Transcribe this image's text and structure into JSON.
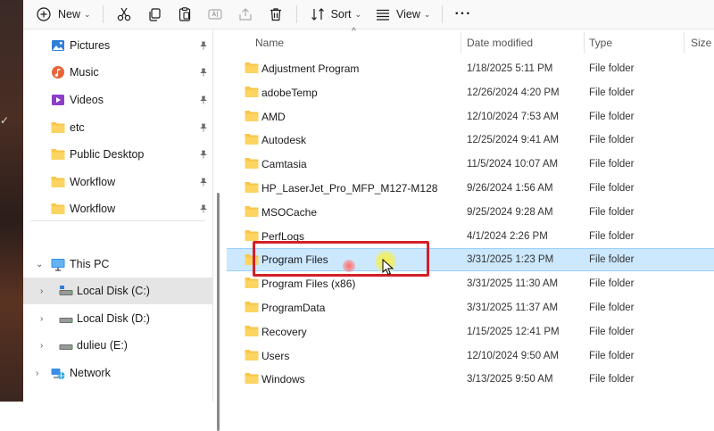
{
  "toolbar": {
    "new_label": "New",
    "sort_label": "Sort",
    "view_label": "View",
    "more_label": "···"
  },
  "nav": {
    "quick_access": [
      {
        "label": "Pictures",
        "icon": "pictures-icon"
      },
      {
        "label": "Music",
        "icon": "music-icon"
      },
      {
        "label": "Videos",
        "icon": "videos-icon"
      },
      {
        "label": "etc",
        "icon": "folder-icon"
      },
      {
        "label": "Public Desktop",
        "icon": "folder-icon"
      },
      {
        "label": "Workflow",
        "icon": "folder-icon"
      },
      {
        "label": "Workflow",
        "icon": "folder-icon"
      }
    ],
    "this_pc": "This PC",
    "drives": [
      {
        "label": "Local Disk (C:)"
      },
      {
        "label": "Local Disk (D:)"
      },
      {
        "label": "dulieu (E:)"
      }
    ],
    "network": "Network"
  },
  "columns": {
    "name": "Name",
    "date": "Date modified",
    "type": "Type",
    "size": "Size"
  },
  "files": [
    {
      "name": "Adjustment Program",
      "date": "1/18/2025 5:11 PM",
      "type": "File folder"
    },
    {
      "name": "adobeTemp",
      "date": "12/26/2024 4:20 PM",
      "type": "File folder"
    },
    {
      "name": "AMD",
      "date": "12/10/2024 7:53 AM",
      "type": "File folder"
    },
    {
      "name": "Autodesk",
      "date": "12/25/2024 9:41 AM",
      "type": "File folder"
    },
    {
      "name": "Camtasia",
      "date": "11/5/2024 10:07 AM",
      "type": "File folder"
    },
    {
      "name": "HP_LaserJet_Pro_MFP_M127-M128",
      "date": "9/26/2024 1:56 AM",
      "type": "File folder"
    },
    {
      "name": "MSOCache",
      "date": "9/25/2024 9:28 AM",
      "type": "File folder"
    },
    {
      "name": "PerfLogs",
      "date": "4/1/2024 2:26 PM",
      "type": "File folder"
    },
    {
      "name": "Program Files",
      "date": "3/31/2025 1:23 PM",
      "type": "File folder"
    },
    {
      "name": "Program Files (x86)",
      "date": "3/31/2025 11:30 AM",
      "type": "File folder"
    },
    {
      "name": "ProgramData",
      "date": "3/31/2025 11:37 AM",
      "type": "File folder"
    },
    {
      "name": "Recovery",
      "date": "1/15/2025 12:41 PM",
      "type": "File folder"
    },
    {
      "name": "Users",
      "date": "12/10/2024 9:50 AM",
      "type": "File folder"
    },
    {
      "name": "Windows",
      "date": "3/13/2025 9:50 AM",
      "type": "File folder"
    }
  ],
  "colors": {
    "selection": "#cce8ff",
    "highlight": "#d32027",
    "folder": "#f8c649"
  }
}
